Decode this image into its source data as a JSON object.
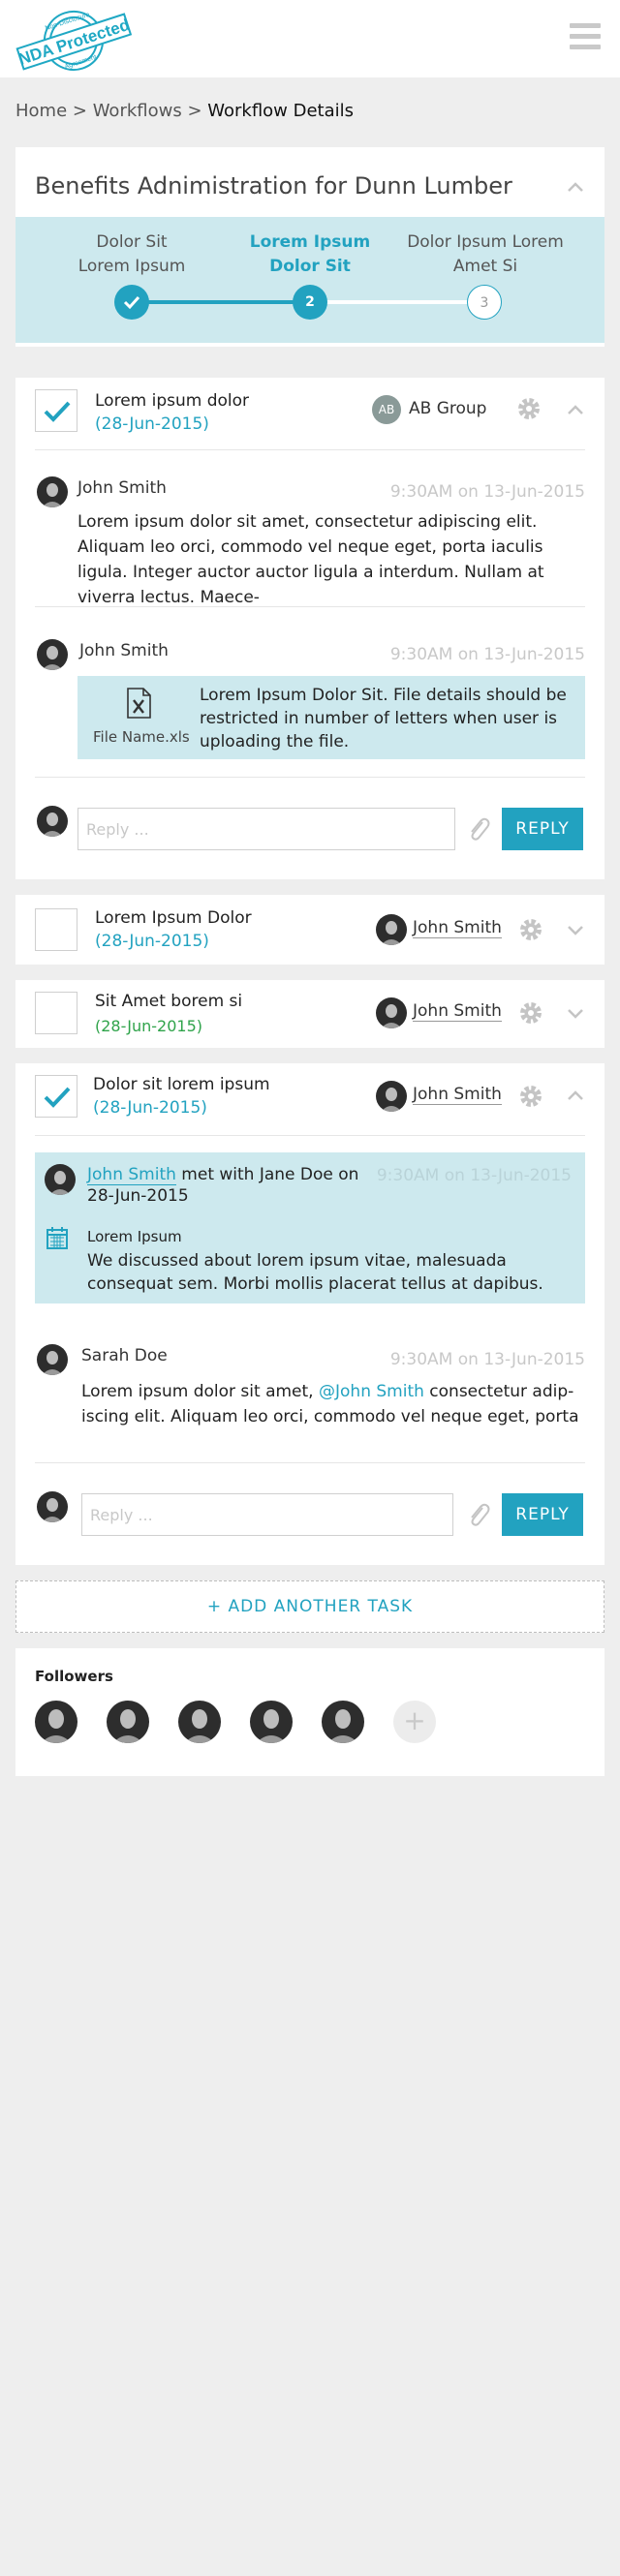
{
  "app": {
    "logo_text": "NDA Protected",
    "logo_ring_top": "Non-Disclosure",
    "logo_ring_bottom": "Agreement"
  },
  "breadcrumb": {
    "home": "Home",
    "sep1": " > ",
    "workflows": "Workflows",
    "sep2": " > ",
    "current": "Workflow Details"
  },
  "workflow": {
    "title": "Benefits Adnimistration for Dunn Lumber",
    "steps": [
      {
        "line1": "Dolor Sit",
        "line2": "Lorem Ipsum",
        "state": "done",
        "marker": ""
      },
      {
        "line1": "Lorem Ipsum",
        "line2": "Dolor Sit",
        "state": "active",
        "marker": "2"
      },
      {
        "line1": "Dolor Ipsum Lorem",
        "line2": "Amet Si",
        "state": "todo",
        "marker": "3"
      }
    ],
    "accent": "#22a2c0",
    "step_bg": "#cde9ee"
  },
  "tasks": [
    {
      "title": "Lorem ipsum dolor",
      "date": "(28-Jun-2015)",
      "checked": true,
      "assignee_initials": "AB",
      "assignee": "AB Group",
      "expanded": true,
      "comments": [
        {
          "author": "John Smith",
          "time": "9:30AM on 13-Jun-2015",
          "body": "Lorem ipsum dolor sit amet, consectetur adipiscing elit. Aliquam leo orci, commodo vel neque eget, porta iaculis ligula. Integer auctor auctor ligula a interdum. Nullam at viverra lectus. Maece-"
        },
        {
          "author": "John Smith",
          "time": "9:30AM on 13-Jun-2015",
          "file_name": "File Name.xls",
          "file_text": "Lorem Ipsum Dolor Sit. File details should be restricted in number of letters when user is uploading the file."
        }
      ],
      "reply_placeholder": "Reply ...",
      "reply_label": "REPLY"
    },
    {
      "title": "Lorem Ipsum Dolor",
      "date": "(28-Jun-2015)",
      "checked": false,
      "assignee": "John Smith",
      "expanded": false
    },
    {
      "title": "Sit Amet borem si",
      "date": "(28-Jun-2015)",
      "checked": false,
      "assignee": "John Smith",
      "expanded": false,
      "date_color": "#2fa34a"
    },
    {
      "title": "Dolor sit lorem ipsum",
      "date": "(28-Jun-2015)",
      "checked": true,
      "assignee": "John Smith",
      "expanded": true,
      "meeting": {
        "who": "John Smith",
        "rest": " met with Jane Doe on 28-Jun-2015",
        "time": "9:30AM on 13-Jun-2015",
        "subject": "Lorem Ipsum",
        "description": "We discussed about lorem ipsum vitae, malesuada consequat sem. Morbi mollis placerat tellus at dapibus."
      },
      "comments": [
        {
          "author": "Sarah Doe",
          "time": "9:30AM on 13-Jun-2015",
          "body_before": "Lorem ipsum dolor sit amet, ",
          "mention": "@John Smith",
          "body_after": " consectetur adip-iscing elit. Aliquam leo orci, commodo vel neque eget, porta"
        }
      ],
      "reply_placeholder": "Reply ...",
      "reply_label": "REPLY"
    }
  ],
  "add_task_label": "+ ADD ANOTHER TASK",
  "followers": {
    "title": "Followers",
    "count": 5,
    "add_symbol": "+"
  }
}
